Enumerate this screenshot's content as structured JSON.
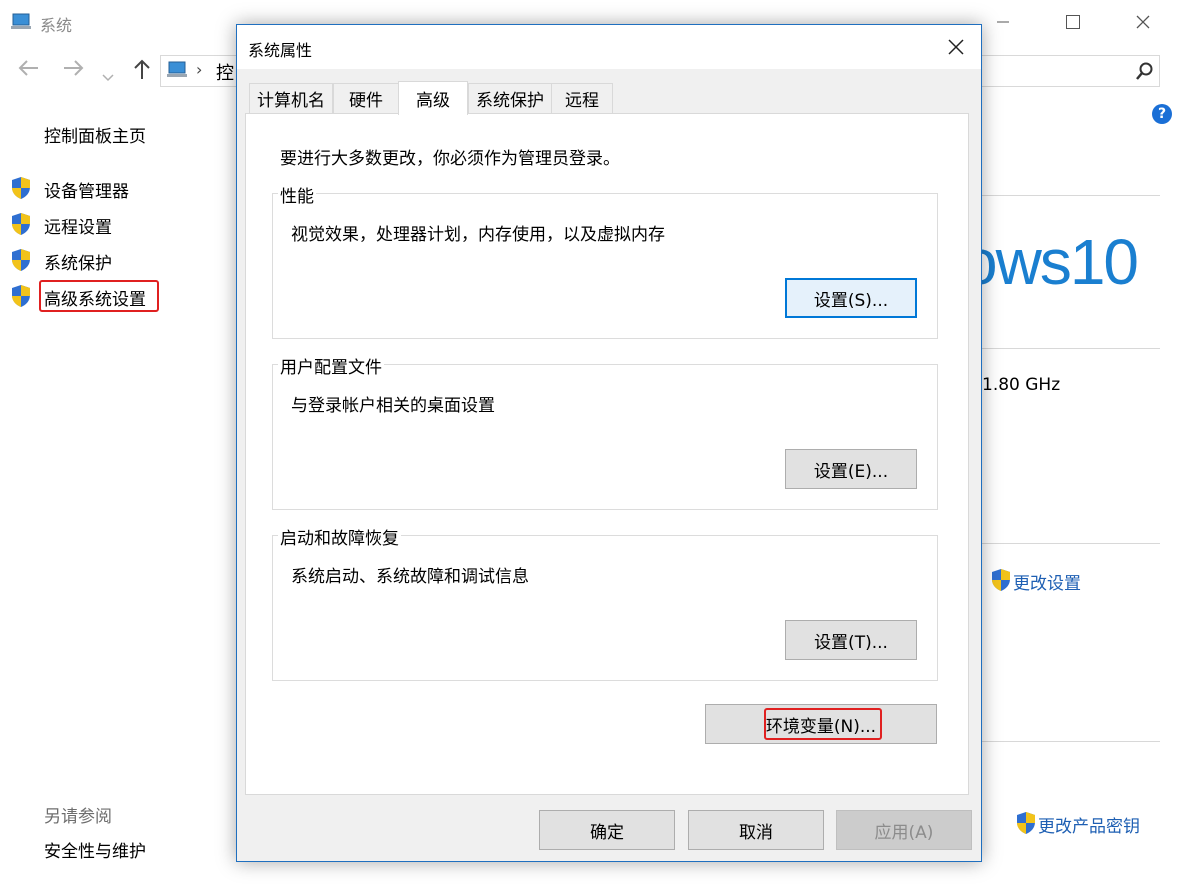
{
  "system_window": {
    "title": "系统",
    "address_crumb": "控",
    "sidebar": {
      "home": "控制面板主页",
      "items": [
        {
          "label": "设备管理器"
        },
        {
          "label": "远程设置"
        },
        {
          "label": "系统保护"
        },
        {
          "label": "高级系统设置"
        }
      ],
      "see_also_heading": "另请参阅",
      "see_also_link": "安全性与维护"
    },
    "windows_logo_text": "ows10",
    "cpu_speed": "1.80 GHz",
    "change_settings": "更改设置",
    "change_product_key": "更改产品密钥",
    "help_symbol": "?"
  },
  "dialog": {
    "title": "系统属性",
    "tabs": [
      {
        "label": "计算机名"
      },
      {
        "label": "硬件"
      },
      {
        "label": "高级"
      },
      {
        "label": "系统保护"
      },
      {
        "label": "远程"
      }
    ],
    "admin_note": "要进行大多数更改，你必须作为管理员登录。",
    "groups": {
      "performance": {
        "title": "性能",
        "description": "视觉效果，处理器计划，内存使用，以及虚拟内存",
        "button": "设置(S)..."
      },
      "user_profiles": {
        "title": "用户配置文件",
        "description": "与登录帐户相关的桌面设置",
        "button": "设置(E)..."
      },
      "startup_recovery": {
        "title": "启动和故障恢复",
        "description": "系统启动、系统故障和调试信息",
        "button": "设置(T)..."
      }
    },
    "env_button": "环境变量(N)...",
    "ok_button": "确定",
    "cancel_button": "取消",
    "apply_button": "应用(A)"
  },
  "colors": {
    "accent": "#0078d7",
    "link": "#1e5fb3",
    "highlight_box": "#e02020",
    "dialog_border": "#1f6fbf"
  }
}
